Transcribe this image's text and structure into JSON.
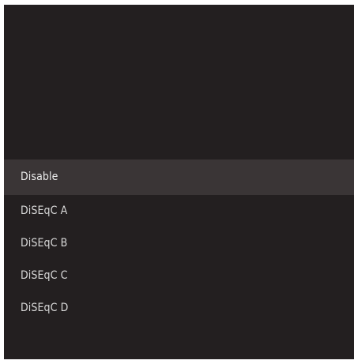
{
  "menu": {
    "options": [
      {
        "label": "Disable",
        "selected": true
      },
      {
        "label": "DiSEqC A",
        "selected": false
      },
      {
        "label": "DiSEqC B",
        "selected": false
      },
      {
        "label": "DiSEqC C",
        "selected": false
      },
      {
        "label": "DiSEqC D",
        "selected": false
      }
    ]
  },
  "colors": {
    "panel_background": "#231f20",
    "selected_row_background": "#3a3536",
    "text": "#d9d9d9"
  }
}
